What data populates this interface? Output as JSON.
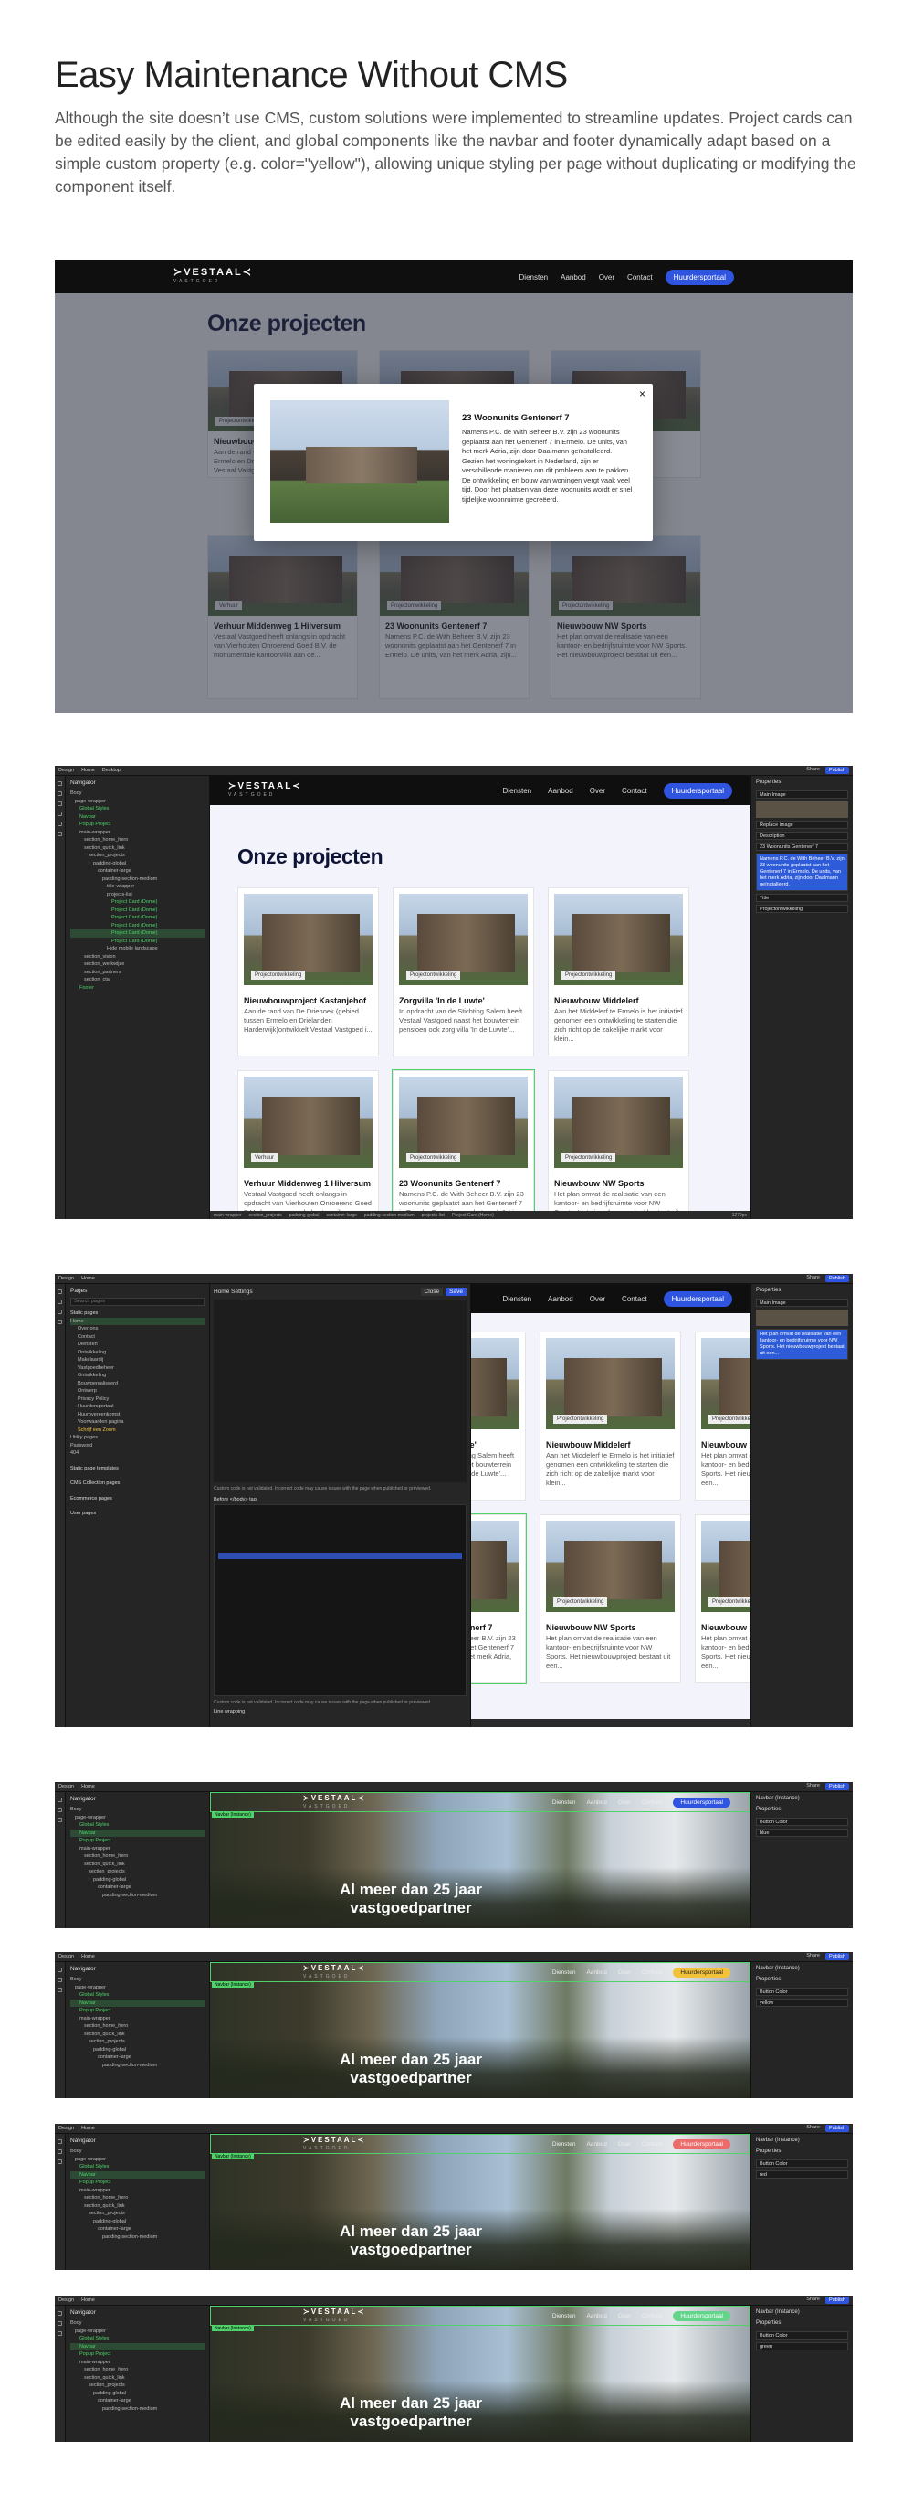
{
  "header": {
    "title": "Easy Maintenance Without CMS",
    "description": "Although the site doesn’t use CMS, custom solutions were implemented to streamline updates. Project cards can be edited easily by the client, and global components like the navbar and footer dynamically adapt based on a simple custom property (e.g. color=\"yellow\"), allowing unique styling per page without duplicating or modifying the component itself."
  },
  "site": {
    "logo": "≻VESTAAL≺",
    "logo_sub": "VASTGOED",
    "nav": [
      "Diensten",
      "Aanbod",
      "Over",
      "Contact"
    ],
    "cta": "Huurdersportaal",
    "page_title": "Onze projecten",
    "hero_title": "Al meer dan 25 jaar vastgoedpartner"
  },
  "modal": {
    "title": "23 Woonunits Gentenerf 7",
    "text": "Namens P.C. de With Beheer B.V. zijn 23 woonunits geplaatst aan het Gentenerf 7 in Ermelo. De units, van het merk Adria, zijn door Daalmann geïnstalleerd. Gezien het woningtekort in Nederland, zijn er verschillende manieren om dit probleem aan te pakken. De ontwikkeling en bouw van woningen vergt vaak veel tijd. Door het plaatsen van deze woonunits wordt er snel tijdelijke woonruimte gecreëerd.",
    "close": "×"
  },
  "cards": [
    {
      "title": "Nieuwbouwproject Kastanjehof",
      "tag": "Projectontwikkeling",
      "desc": "Aan de rand van De Driehoek (gebied tussen Ermelo en Drielanden Harderwijk)ontwikkelt Vestaal Vastgoed i..."
    },
    {
      "title": "Zorgvilla 'In de Luwte'",
      "tag": "Projectontwikkeling",
      "desc": "In opdracht van de Stichting Salem heeft Vestaal Vastgoed naast het bouwterrein pensioen ook zorg villa 'In de Luwte'..."
    },
    {
      "title": "Nieuwbouw Middelerf",
      "tag": "Projectontwikkeling",
      "desc": "Aan het Middelerf te Ermelo is het initiatief genomen een ontwikkeling te starten die zich richt op de zakelijke markt voor klein..."
    },
    {
      "title": "Verhuur Middenweg 1 Hilversum",
      "tag": "Verhuur",
      "desc": "Vestaal Vastgoed heeft onlangs in opdracht van Vierhouten Onroerend Goed B.V. de monumentale kantoorvilla aan de..."
    },
    {
      "title": "23 Woonunits Gentenerf 7",
      "tag": "Projectontwikkeling",
      "desc": "Namens P.C. de With Beheer B.V. zijn 23 woonunits geplaatst aan het Gentenerf 7 in Ermelo. De units, van het merk Adria, zijn..."
    },
    {
      "title": "Nieuwbouw NW Sports",
      "tag": "Projectontwikkeling",
      "desc": "Het plan omvat de realisatie van een kantoor- en bedrijfsruimte voor NW Sports. Het nieuwbouwproject bestaat uit een..."
    }
  ],
  "designer": {
    "top_left": [
      "Design",
      "Home",
      "Desktop"
    ],
    "top_right": [
      "Share",
      "Publish"
    ],
    "navigator_label": "Navigator",
    "tree": [
      "Body",
      "page-wrapper",
      "Global Styles",
      "Navbar",
      "Popup Project",
      "main-wrapper",
      "section_home_hero",
      "section_quick_link",
      "section_projects",
      "padding-global",
      "container-large",
      "padding-section-medium",
      "title-wrapper",
      "projects-list",
      "Project Card (Dome)",
      "Project Card (Dome)",
      "Project Card (Dome)",
      "Project Card (Dome)",
      "Project Card (Dome)",
      "Project Card (Dome)",
      "Hide mobile landscape",
      "section_vision",
      "section_werkwijze",
      "section_partners",
      "section_cta",
      "Footer"
    ],
    "props_label": "Properties",
    "props": [
      "Main Image",
      "Replace image",
      "Description",
      "23 Woonunits Gentenerf 7",
      "Title",
      "Projectontwikkeling"
    ],
    "props_highlight": "Namens P.C. de With Beheer B.V. zijn 23 woonunits geplaatst aan het Gentenerf 7 in Ermelo. De units, van het merk Adria, zijn door Daalmann geïnstalleerd.",
    "bottom": [
      "main-wrapper",
      "section_projects",
      "padding-global",
      "container-large",
      "padding-section-medium",
      "projects-list",
      "Project Card (Home)"
    ],
    "zoom": "1279px"
  },
  "pages_panel": {
    "title": "Pages",
    "search": "Search pages",
    "static": "Static pages",
    "list": [
      "Home",
      "Over ons",
      "Contact",
      "Diensten",
      "Ontwikkeling",
      "Makelaardij",
      "Vastgoedbeheer",
      "Ontwikkeling",
      "Bouwgerealiseerd",
      "Ontwerp",
      "Privacy Policy",
      "Huurdersportaal",
      "Huurovereenkomst",
      "Voorwaarden pagina",
      "Schrijf een Zoom",
      "Utility pages",
      "Password",
      "404"
    ],
    "sections": [
      "Static page templates",
      "CMS Collection pages",
      "Ecommerce pages",
      "User pages"
    ],
    "settings_title": "Home Settings",
    "code_label": "Before </body> tag",
    "code_note": "Custom code is not validated. Incorrect code may cause issues with the page when published or previewed.",
    "wrap": "Line wrapping",
    "close": "Close",
    "save": "Save"
  },
  "navbar_variants": [
    {
      "color_label": "Button Color",
      "color_value": "blue",
      "pill_color": "#2f54e0"
    },
    {
      "color_label": "Button Color",
      "color_value": "yellow",
      "pill_color": "#f2c23b"
    },
    {
      "color_label": "Button Color",
      "color_value": "red",
      "pill_color": "#ec6b6b"
    },
    {
      "color_label": "Button Color",
      "color_value": "green",
      "pill_color": "#62d58a"
    }
  ],
  "navbar_component": "Navbar (Instance)"
}
